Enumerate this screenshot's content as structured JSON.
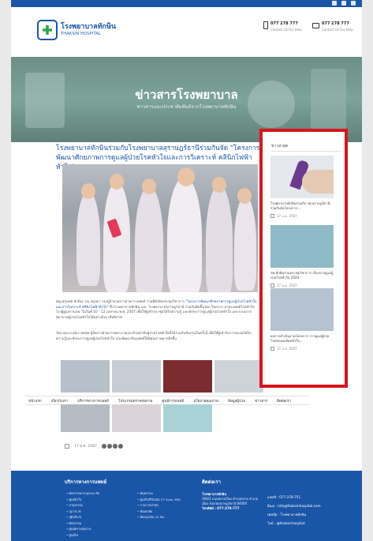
{
  "header": {
    "logo_th": "โรงพยาบาลทักษิน",
    "logo_en": "THAKSIN HOSPITAL",
    "phone_1": "077 278 777",
    "phone_1_sub": "Contact Us For Help",
    "phone_2": "077 278 777",
    "phone_2_sub": "Contact Us For Help"
  },
  "hero": {
    "title": "ข่าวสารโรงพยาบาล",
    "subtitle": "ข่าวสารและประชาสัมพันธ์จากโรงพยาบาลทักษิน"
  },
  "article": {
    "title": "โรงพยาบาลทักษินร่วมกับโรงพยาบาลสุราษฎร์ธานีร่วมกันจัด \"โครงการพัฒนาศักยภาพการดูแลผู้ป่วยโรคหัวใจและการวิเคราะห์ คลินิกไฟฟ้าหัวใจ\"",
    "para1_a": "พญ.สุกุมลย์ ทักษิณ วณ อดุลยา รองผู้อำนวยการฝ่ายการแพทย์ ร่วมพิธีเปิดประชุมวิชาการ ",
    "para1_hl": "\"โครงการพัฒนาศักยภาพการดูแลผู้ป่วยโรคหัวใจและการวิเคราะห์ คลินิกไฟฟ้าหัวใจ\"",
    "para1_b": " ซึ่งโรงพยาบาลทักษิน และ โรงพยาบาลสุราษฎร์ธานี ร่วมกันจัดขึ้นโดย วิทยากร อายุรแพทย์โรคหัวใจ โรงผู้ดูแลงานรพ. ในวันที่ 10 - 12 เมษายน พ.ศ. 2567 เพื่อให้ผู้เข้าประชุมได้รับความรู้ และทักษะการดูแลผู้ป่วยโรคหัวใจ และระบบการพยาบาลผู้ป่วยโรคหัวใจได้อย่างมีประสิทธิภาพ",
    "para2": "โดย คุณวรเนียร หทพล ผู้จัดการฝ่ายการพยาบาลและหัวหน้าทีมผู้ป่วยโรคหัวใจที่ได้ร่วมกันจัดงานในครั้งนี้ เพื่อให้ผู้เข้ารับการอบรมได้รับความรู้และทักษะการดูแลผู้ป่วยโรคหัวใจ และพัฒนาทีมแพทย์ให้มีคุณภาพมากยิ่งขึ้น",
    "date": "17 ม.ค. 2567"
  },
  "menu": [
    "หน้าแรก",
    "เกี่ยวกับเรา",
    "บริการทางการแพทย์",
    "โปรแกรมตรวจสุขภาพ",
    "ศูนย์การแพทย์",
    "นโยบายคุณภาพ",
    "ข้อมูลผู้ป่วย",
    "ข่าวสาร",
    "ติดต่อเรา"
  ],
  "sidebar": {
    "heading": "ข่าวล่าสุด",
    "items": [
      {
        "caption": "โรงพยาบาลทักษินร่วมกับ รพ.สุราษฎร์ธานี ร่วมกันจัดโครงการ...",
        "date": "17 ม.ค. 2567"
      },
      {
        "caption": "รพ.ทักษินร่วมประชุมวิชาการ เรื่องการดูแลผู้ป่วยโรคหัวใจ 2024",
        "date": "17 ม.ค. 2567"
      },
      {
        "caption": "ผลการดำเนินงานโครงการ การดูแลผู้ป่วยโรคหลอดเลือดหัวใจ...",
        "date": "17 ม.ค. 2567"
      }
    ]
  },
  "footer": {
    "col1_title": "บริการทางการแพทย์",
    "col1_links": [
      "ศัลยกรรมกระดูกและข้อ",
      "ศูนย์หัวใจ",
      "อายุรกรรม",
      "กุมารเวช",
      "สูตินรีเวช",
      "ศัลยกรรม",
      "ศูนย์ตรวจสุขภาพ",
      "ศูนย์ไต"
    ],
    "col2_links": [
      "ทันตกรรม",
      "ศูนย์รังสีวินิจฉัย CT Scan, MRI",
      "กายภาพบำบัด",
      "ห้องผ่าตัด",
      "ห้องฉุกเฉิน 24 ชม."
    ],
    "col3_title": "ติดต่อเรา",
    "address_title": "โรงพยาบาลทักษิน",
    "address": "309/2 ถนนตลาดใหม่ ตำบลตลาด อำเภอเมือง จังหวัดสุราษฎร์ธานี 84000",
    "tel": "โทรศัพท์ : 077-278-777",
    "contact_lines": [
      "แฟกซ์ : 077-278-751",
      "อีเมล : info@thaksinhospital.com",
      "เฟสบุ๊ค : โรงพยาบาลทักษิน",
      "ไลน์ : @thaksinhospital"
    ]
  }
}
